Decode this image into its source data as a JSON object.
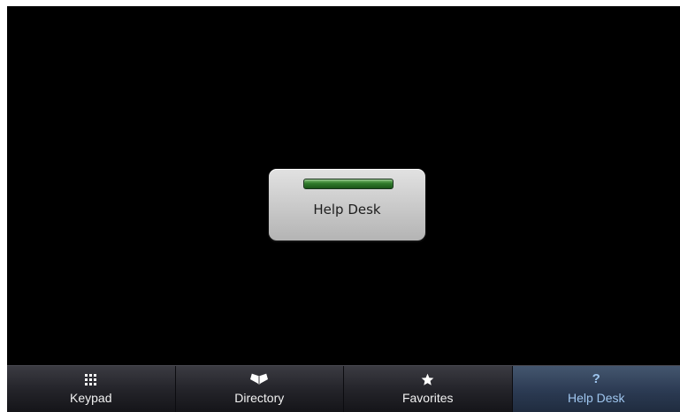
{
  "main": {
    "help_button": {
      "label": "Help Desk",
      "indicator_color": "#2f7a2a"
    }
  },
  "tabbar": {
    "tabs": [
      {
        "id": "keypad",
        "label": "Keypad",
        "icon": "keypad-grid-icon",
        "active": false
      },
      {
        "id": "directory",
        "label": "Directory",
        "icon": "open-book-icon",
        "active": false
      },
      {
        "id": "favorites",
        "label": "Favorites",
        "icon": "star-icon",
        "active": false
      },
      {
        "id": "helpdesk",
        "label": "Help Desk",
        "icon": "question-mark-icon",
        "active": true,
        "icon_glyph": "?"
      }
    ],
    "active_color": "#9fc6ef"
  }
}
